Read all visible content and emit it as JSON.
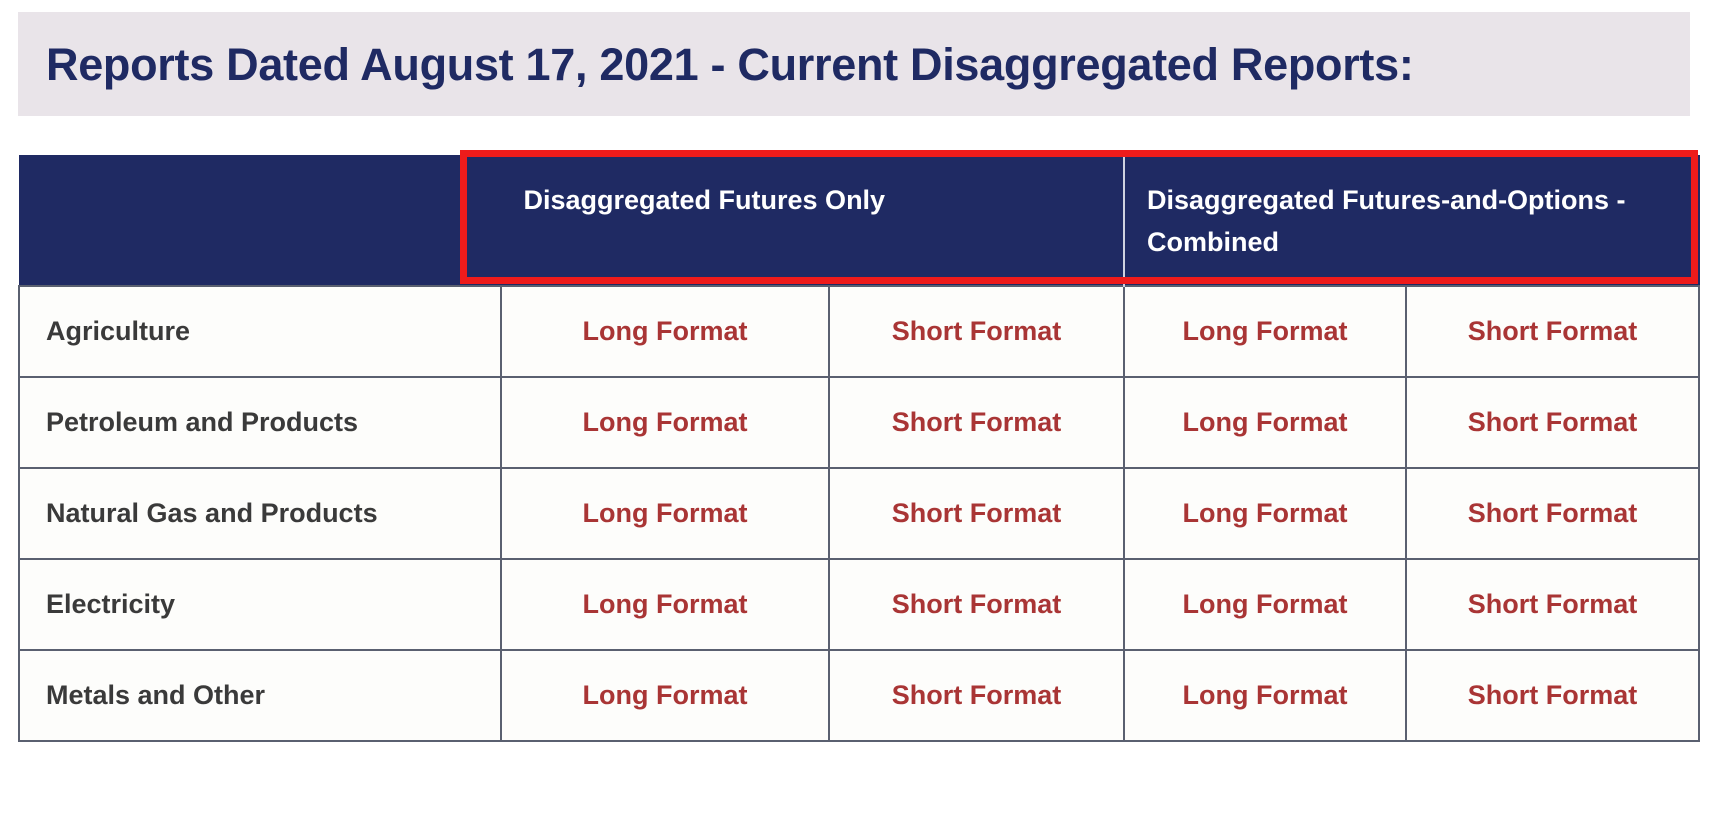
{
  "page": {
    "title": "Reports Dated August 17, 2021 - Current Disaggregated Reports:"
  },
  "colors": {
    "header_navy": "#1f2a63",
    "banner_bg": "#e9e4e9",
    "link_red": "#a93535",
    "highlight_red": "#ee1b1b",
    "grid_line": "#5a6070"
  },
  "table": {
    "corner_header": "",
    "group_headers": [
      {
        "label": "Disaggregated Futures Only",
        "colspan": 2,
        "highlighted": true
      },
      {
        "label": "Disaggregated Futures-and-Options -Combined",
        "colspan": 2,
        "highlighted": true
      }
    ],
    "format_labels": {
      "long": "Long Format",
      "short": "Short Format"
    },
    "rows": [
      {
        "category": "Agriculture",
        "futures_only_long": "Long Format",
        "futures_only_short": "Short Format",
        "combined_long": "Long Format",
        "combined_short": "Short Format"
      },
      {
        "category": "Petroleum and Products",
        "futures_only_long": "Long Format",
        "futures_only_short": "Short Format",
        "combined_long": "Long Format",
        "combined_short": "Short Format"
      },
      {
        "category": "Natural Gas and Products",
        "futures_only_long": "Long Format",
        "futures_only_short": "Short Format",
        "combined_long": "Long Format",
        "combined_short": "Short Format"
      },
      {
        "category": "Electricity",
        "futures_only_long": "Long Format",
        "futures_only_short": "Short Format",
        "combined_long": "Long Format",
        "combined_short": "Short Format"
      },
      {
        "category": "Metals and Other",
        "futures_only_long": "Long Format",
        "futures_only_short": "Short Format",
        "combined_long": "Long Format",
        "combined_short": "Short Format"
      }
    ]
  }
}
